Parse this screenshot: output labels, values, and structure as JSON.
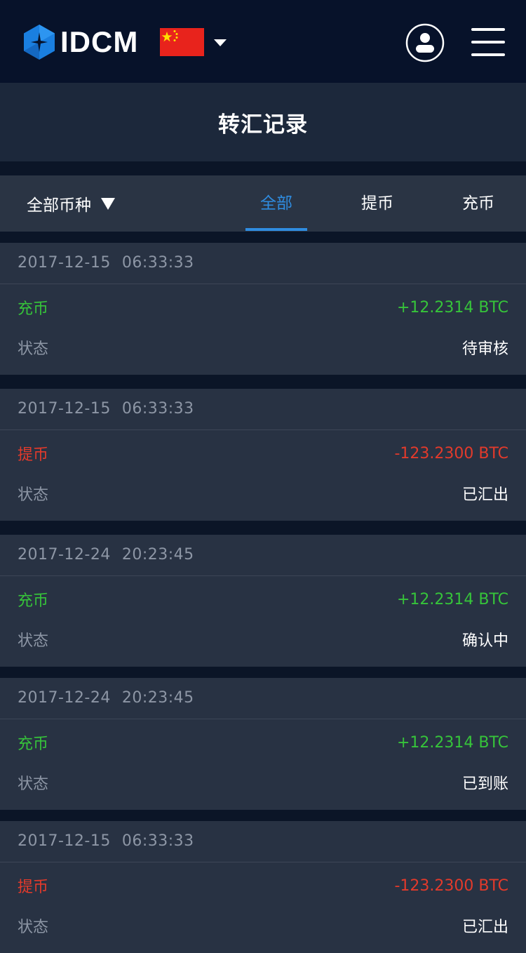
{
  "header": {
    "brand": "IDCM",
    "language_flag": "china-flag",
    "title": "转汇记录"
  },
  "filters": {
    "coin_filter": "全部币种",
    "tabs": [
      {
        "label": "全部",
        "active": true
      },
      {
        "label": "提币",
        "active": false
      },
      {
        "label": "充币",
        "active": false
      }
    ]
  },
  "colors": {
    "accent": "#2f8ce0",
    "deposit": "#36c43a",
    "withdraw": "#e23a2b"
  },
  "records": [
    {
      "date": "2017-12-15",
      "time": "06:33:33",
      "type": "充币",
      "type_kind": "deposit",
      "amount": "+12.2314 BTC",
      "status_label": "状态",
      "status": "待审核"
    },
    {
      "date": "2017-12-15",
      "time": "06:33:33",
      "type": "提币",
      "type_kind": "withdraw",
      "amount": "-123.2300 BTC",
      "status_label": "状态",
      "status": "已汇出"
    },
    {
      "date": "2017-12-24",
      "time": "20:23:45",
      "type": "充币",
      "type_kind": "deposit",
      "amount": "+12.2314 BTC",
      "status_label": "状态",
      "status": "确认中"
    },
    {
      "date": "2017-12-24",
      "time": "20:23:45",
      "type": "充币",
      "type_kind": "deposit",
      "amount": "+12.2314 BTC",
      "status_label": "状态",
      "status": "已到账"
    },
    {
      "date": "2017-12-15",
      "time": "06:33:33",
      "type": "提币",
      "type_kind": "withdraw",
      "amount": "-123.2300 BTC",
      "status_label": "状态",
      "status": "已汇出"
    }
  ]
}
